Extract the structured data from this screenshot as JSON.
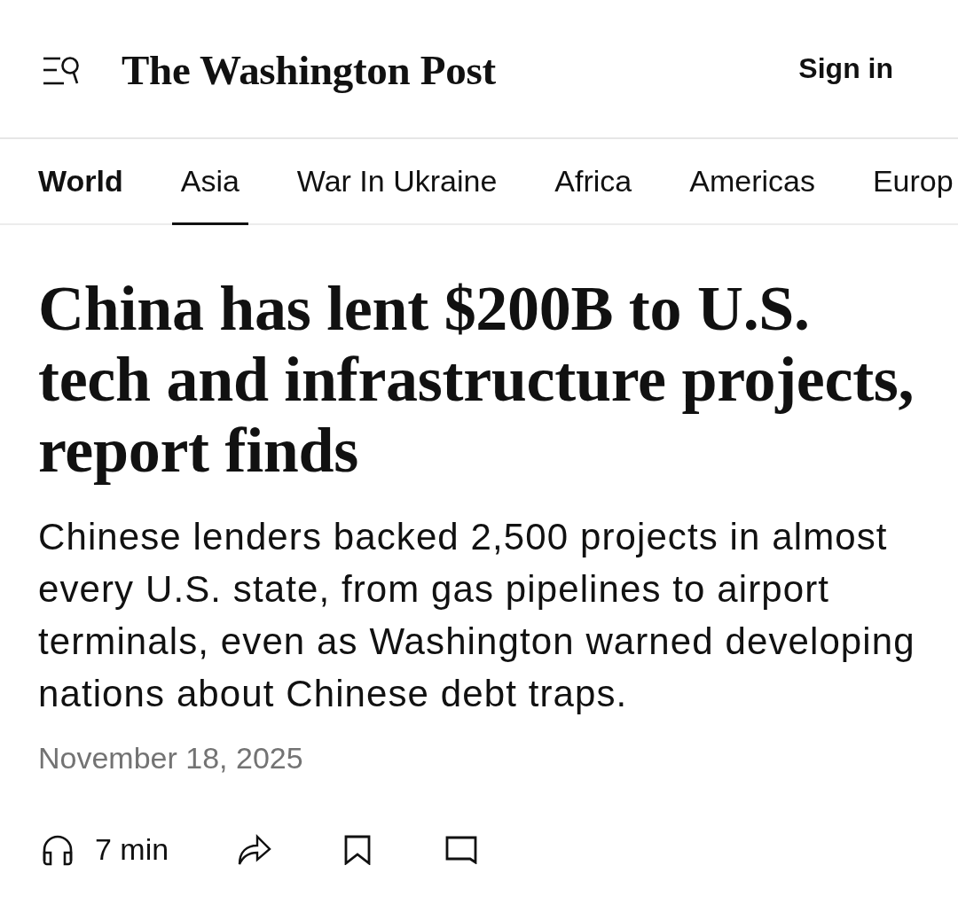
{
  "header": {
    "logo": "The Washington Post",
    "sign_in": "Sign in"
  },
  "nav": {
    "items": [
      {
        "label": "World",
        "kind": "section",
        "selected": false
      },
      {
        "label": "Asia",
        "kind": "tab",
        "selected": true
      },
      {
        "label": "War In Ukraine",
        "kind": "tab",
        "selected": false
      },
      {
        "label": "Africa",
        "kind": "tab",
        "selected": false
      },
      {
        "label": "Americas",
        "kind": "tab",
        "selected": false
      },
      {
        "label": "Europ",
        "kind": "tab",
        "selected": false
      }
    ]
  },
  "article": {
    "headline": "China has lent $200B to U.S. tech and infrastructure projects, report finds",
    "dek": "Chinese lenders backed 2,500 projects in almost every U.S. state, from gas pipelines to airport terminals, even as Washington warned developing nations about Chinese debt traps.",
    "date": "November 18, 2025"
  },
  "actions": {
    "read_time": "7 min"
  }
}
